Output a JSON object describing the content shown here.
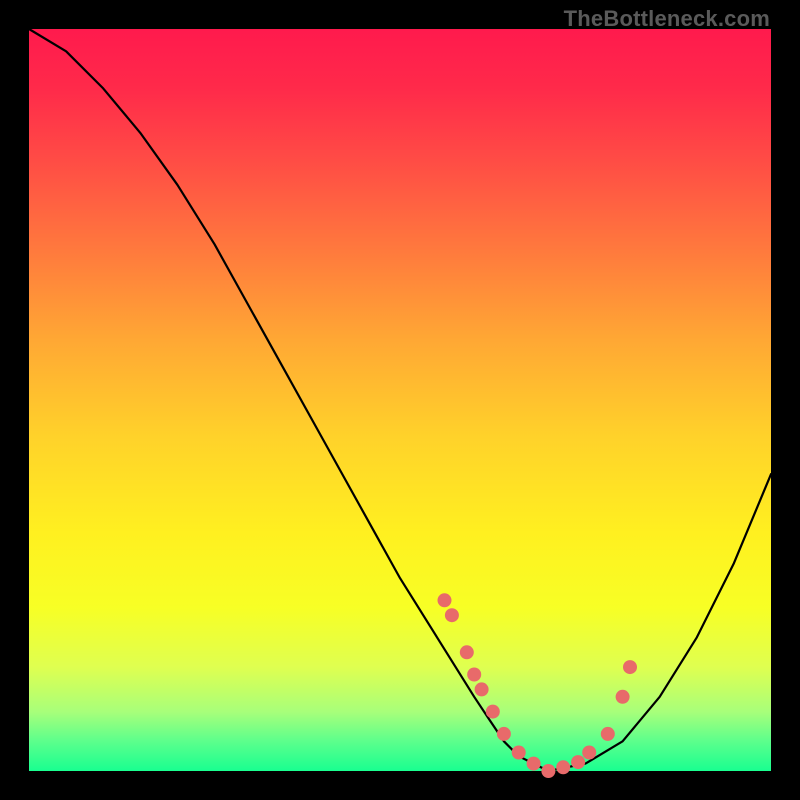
{
  "watermark": "TheBottleneck.com",
  "chart_data": {
    "type": "line",
    "title": "",
    "xlabel": "",
    "ylabel": "",
    "xlim": [
      0,
      100
    ],
    "ylim": [
      0,
      100
    ],
    "series": [
      {
        "name": "bottleneck-curve",
        "x": [
          0,
          5,
          10,
          15,
          20,
          25,
          30,
          35,
          40,
          45,
          50,
          55,
          60,
          62,
          64,
          66,
          68,
          70,
          75,
          80,
          85,
          90,
          95,
          100
        ],
        "values": [
          100,
          97,
          92,
          86,
          79,
          71,
          62,
          53,
          44,
          35,
          26,
          18,
          10,
          7,
          4,
          2,
          1,
          0,
          1,
          4,
          10,
          18,
          28,
          40
        ]
      }
    ],
    "points": {
      "name": "highlight-dots",
      "x": [
        56,
        57,
        59,
        60,
        61,
        62.5,
        64,
        66,
        68,
        70,
        72,
        74,
        75.5,
        78,
        80,
        81
      ],
      "values": [
        23,
        21,
        16,
        13,
        11,
        8,
        5,
        2.5,
        1,
        0,
        0.5,
        1.2,
        2.5,
        5,
        10,
        14
      ]
    },
    "grid": false,
    "legend_position": "none"
  }
}
